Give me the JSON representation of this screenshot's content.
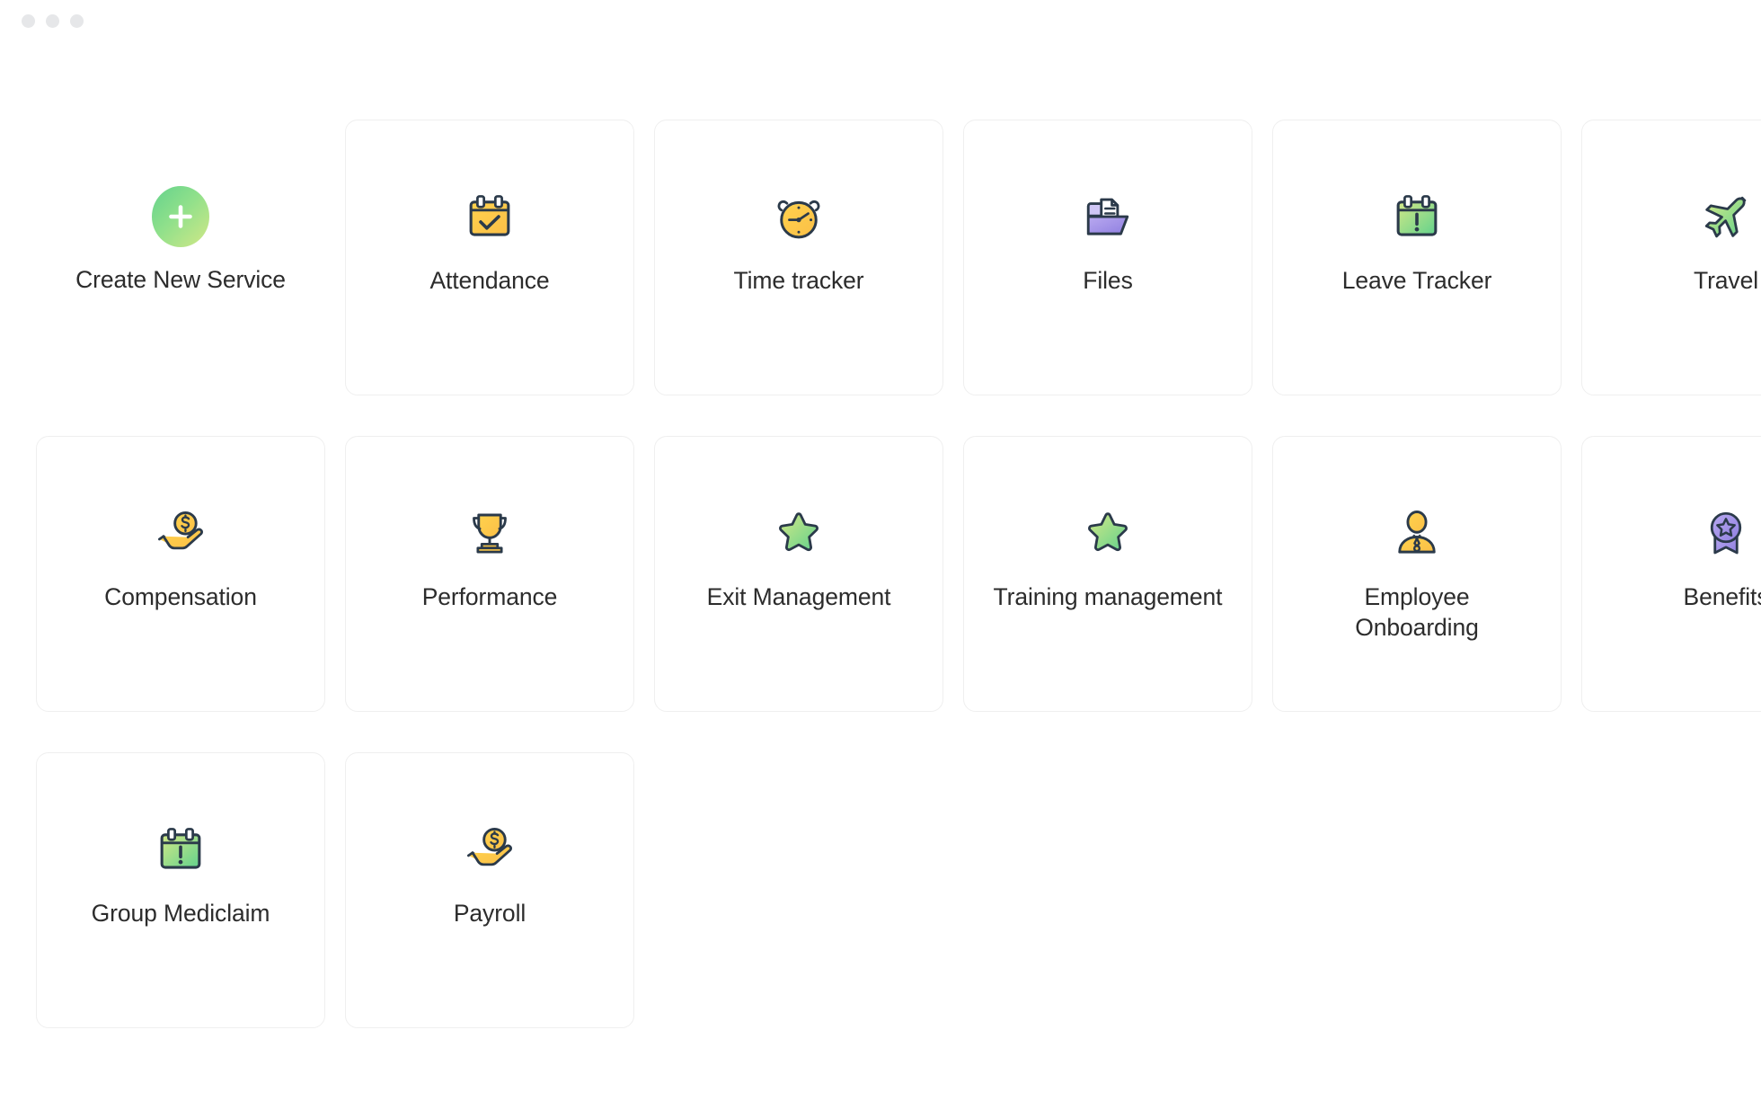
{
  "window": {
    "dots": [
      "close-dot",
      "minimize-dot",
      "maximize-dot"
    ]
  },
  "colors": {
    "background": "#ffffff",
    "card_border": "#efefef",
    "label_text": "#2c2c2c",
    "icon_outline": "#2b3a4a",
    "accent_green_start": "#63d28c",
    "accent_green_end": "#d2e887",
    "accent_yellow_start": "#ffd24d",
    "accent_yellow_end": "#fbbf47",
    "accent_purple_start": "#b9a9f0",
    "accent_purple_end": "#8f7fe0",
    "dot_gray": "#e6e7e9"
  },
  "services": [
    {
      "label": "Create New Service",
      "icon": "plus-circle-icon",
      "card": false
    },
    {
      "label": "Attendance",
      "icon": "calendar-check-icon",
      "card": true
    },
    {
      "label": "Time tracker",
      "icon": "alarm-clock-icon",
      "card": true
    },
    {
      "label": "Files",
      "icon": "folder-document-icon",
      "card": true
    },
    {
      "label": "Leave Tracker",
      "icon": "calendar-alert-icon",
      "card": true
    },
    {
      "label": "Travel",
      "icon": "airplane-icon",
      "card": true
    },
    {
      "label": "Compensation",
      "icon": "hand-coin-icon",
      "card": true
    },
    {
      "label": "Performance",
      "icon": "trophy-icon",
      "card": true
    },
    {
      "label": "Exit Management",
      "icon": "star-icon",
      "card": true
    },
    {
      "label": "Training management",
      "icon": "star-icon",
      "card": true
    },
    {
      "label": "Employee Onboarding",
      "icon": "person-tie-icon",
      "card": true
    },
    {
      "label": "Benefits",
      "icon": "award-badge-icon",
      "card": true
    },
    {
      "label": "Group Mediclaim",
      "icon": "calendar-alert-icon",
      "card": true
    },
    {
      "label": "Payroll",
      "icon": "hand-coin-icon",
      "card": true
    }
  ]
}
